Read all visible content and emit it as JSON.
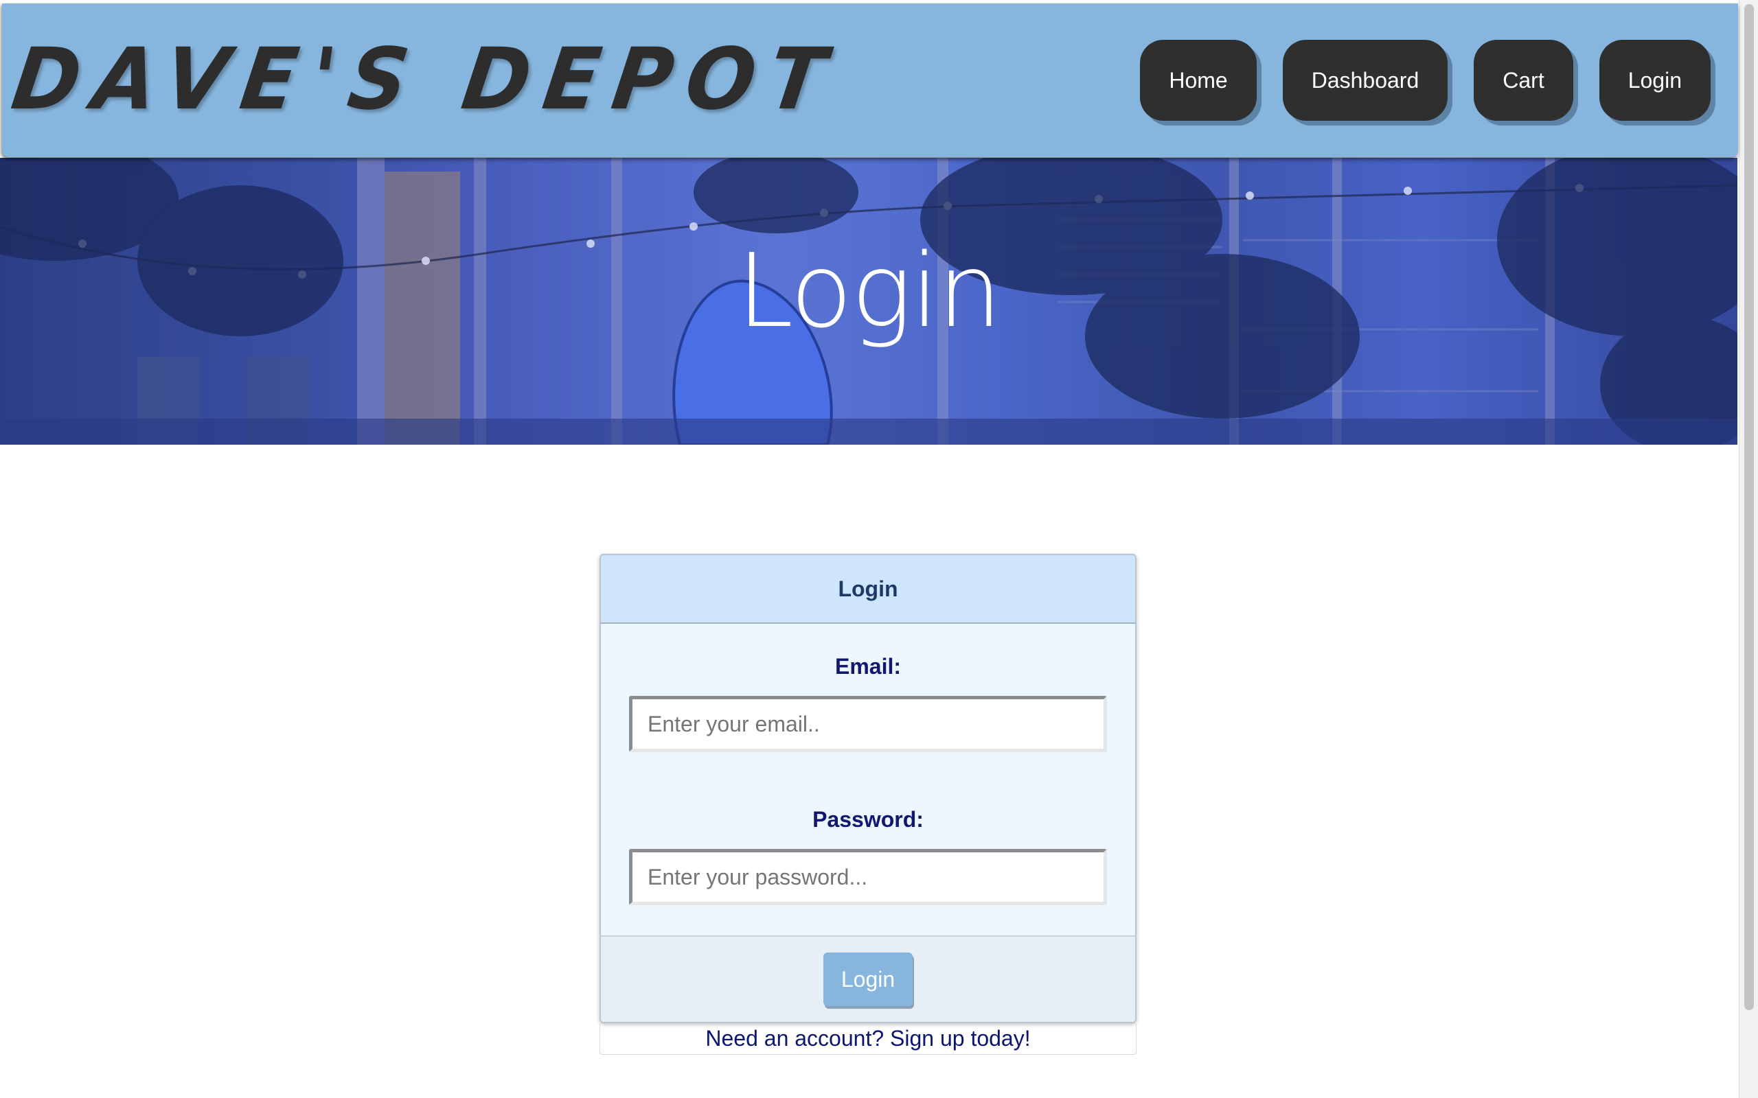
{
  "header": {
    "brand": "DAVE'S DEPOT",
    "nav": [
      {
        "label": "Home"
      },
      {
        "label": "Dashboard"
      },
      {
        "label": "Cart"
      },
      {
        "label": "Login"
      }
    ]
  },
  "hero": {
    "title": "Login"
  },
  "login_card": {
    "title": "Login",
    "email_label": "Email:",
    "email_placeholder": "Enter your email..",
    "email_value": "",
    "password_label": "Password:",
    "password_placeholder": "Enter your password...",
    "password_value": "",
    "submit_label": "Login",
    "signup_link": "Need an account? Sign up today!"
  },
  "colors": {
    "navbar": "#86b6de",
    "nav_button": "#2f2f2f",
    "card_header": "#cfe5fc",
    "card_body": "#eef6ff",
    "label_text": "#101870",
    "submit_button": "#86b6de"
  }
}
